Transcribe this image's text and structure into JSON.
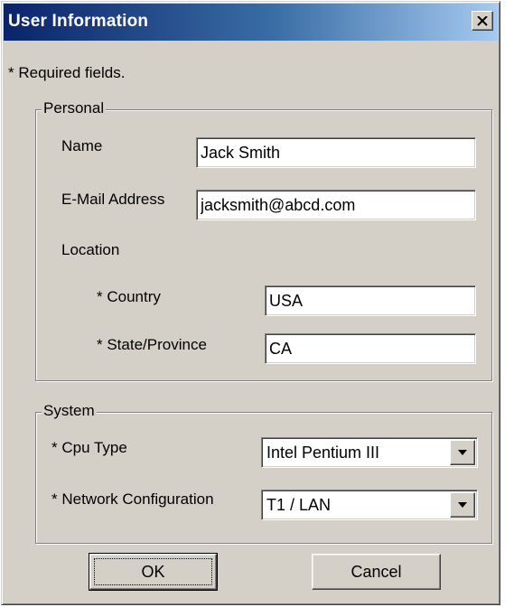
{
  "window": {
    "title": "User Information",
    "close_icon": "close-icon"
  },
  "required_note": "* Required fields.",
  "personal": {
    "legend": "Personal",
    "name_label": "Name",
    "name_value": "Jack Smith",
    "email_label": "E-Mail Address",
    "email_value": "jacksmith@abcd.com",
    "location_label": "Location",
    "country_label": "* Country",
    "country_value": "USA",
    "state_label": "* State/Province",
    "state_value": "CA"
  },
  "system": {
    "legend": "System",
    "cpu_label": "* Cpu Type",
    "cpu_value": "Intel Pentium III",
    "network_label": "* Network Configuration",
    "network_value": "T1 / LAN",
    "dropdown_icon": "chevron-down-icon"
  },
  "buttons": {
    "ok_label": "OK",
    "cancel_label": "Cancel"
  },
  "colors": {
    "titlebar_start": "#0a246a",
    "titlebar_end": "#a6caf0",
    "window_bg": "#d4d0c8"
  }
}
